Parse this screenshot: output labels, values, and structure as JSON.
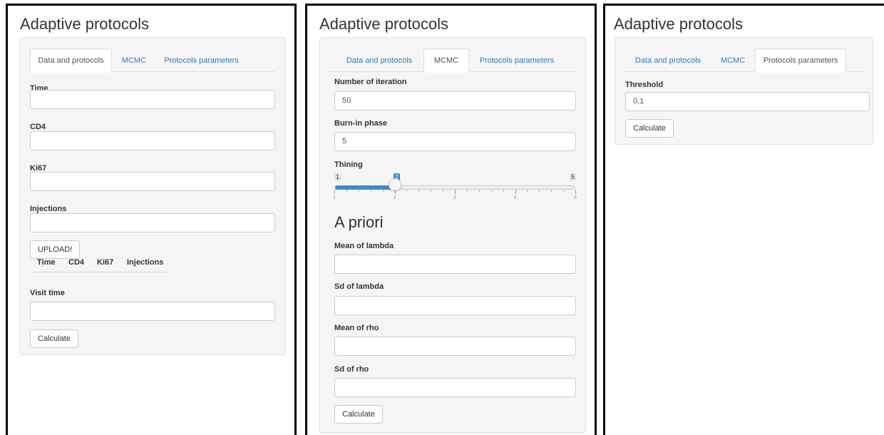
{
  "app_title": "Adaptive protocols",
  "tabs": [
    "Data and protocols",
    "MCMC",
    "Protocols parameters"
  ],
  "panel_data": {
    "active_tab": "Data and protocols",
    "fields": [
      {
        "label": "Time",
        "value": ""
      },
      {
        "label": "CD4",
        "value": ""
      },
      {
        "label": "Ki67",
        "value": ""
      },
      {
        "label": "Injections",
        "value": ""
      }
    ],
    "upload_button": "UPLOAD!",
    "table_columns": [
      "Time",
      "CD4",
      "Ki67",
      "Injections"
    ],
    "visit_time": {
      "label": "Visit time",
      "value": ""
    },
    "calculate_button": "Calculate"
  },
  "panel_mcmc": {
    "active_tab": "MCMC",
    "number_of_iteration": {
      "label": "Number of iteration",
      "value": "50"
    },
    "burn_in": {
      "label": "Burn-in phase",
      "value": "5"
    },
    "thining": {
      "label": "Thining",
      "min": "1",
      "max": "5",
      "value": "2",
      "tick_labels": [
        "1",
        "2",
        "3",
        "4",
        "5"
      ]
    },
    "a_priori_title": "A priori",
    "priors": [
      {
        "label": "Mean of lambda",
        "value": ""
      },
      {
        "label": "Sd of lambda",
        "value": ""
      },
      {
        "label": "Mean of rho",
        "value": ""
      },
      {
        "label": "Sd of rho",
        "value": ""
      }
    ],
    "calculate_button": "Calculate"
  },
  "panel_params": {
    "active_tab": "Protocols parameters",
    "threshold": {
      "label": "Threshold",
      "value": "0,1"
    },
    "calculate_button": "Calculate"
  },
  "colors": {
    "link": "#337ab7",
    "slider_accent": "#428bca",
    "well_bg": "#f5f5f5"
  }
}
